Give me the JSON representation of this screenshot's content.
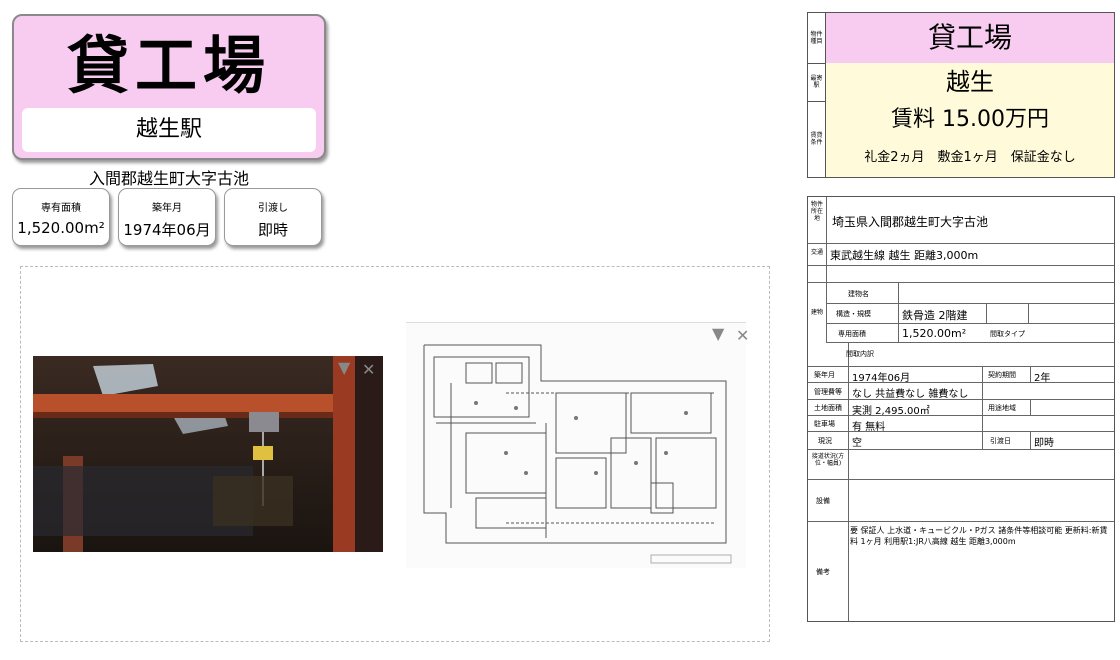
{
  "listing": {
    "title": "貸工場",
    "station": "越生駅",
    "address_short": "入間郡越生町大字古池"
  },
  "info_cards": [
    {
      "label": "専有面積",
      "value": "1,520.00m²"
    },
    {
      "label": "築年月",
      "value": "1974年06月"
    },
    {
      "label": "引渡し",
      "value": "即時"
    }
  ],
  "photo_controls": {
    "sort_glyph": "▼",
    "close_glyph": "✕"
  },
  "summary": {
    "type_label": "物件種目",
    "type_value": "貸工場",
    "station_label": "最寄駅",
    "station_value": "越生",
    "terms_label": "賃貸条件",
    "rent": "賃料 15.00万円",
    "deposit": "礼金2ヵ月　敷金1ヶ月　保証金なし"
  },
  "details": {
    "location_label": "物件所在地",
    "location": "埼玉県入間郡越生町大字古池",
    "transport_label": "交通",
    "transport": "東武越生線 越生 距離3,000m",
    "building_label": "建物",
    "building_name_label": "建物名",
    "structure_label": "構造・規模",
    "structure": "鉄骨造 2階建",
    "area_label": "専用面積",
    "area": "1,520.00m²",
    "layout_type_label": "間取タイプ",
    "layout_detail_label": "間取内訳",
    "built_label": "築年月",
    "built": "1974年06月",
    "contract_label": "契約期間",
    "contract": "2年",
    "fees_label": "管理費等",
    "fees": "なし 共益費なし 雑費なし",
    "land_label": "土地面積",
    "land": "実測 2,495.00㎡",
    "zoning_label": "用途地域",
    "parking_label": "駐車場",
    "parking": "有 無料",
    "status_label": "現況",
    "status": "空",
    "handover_label": "引渡日",
    "handover": "即時",
    "road_label": "接道状況(方位・幅員)",
    "equipment_label": "設備",
    "remarks_label": "備考",
    "remarks": "要 保証人 上水道・キュービクル・Pガス 諸条件等相談可能 更新料:新賃料 1ヶ月 利用駅1:JR八高線 越生 距離3,000m"
  }
}
